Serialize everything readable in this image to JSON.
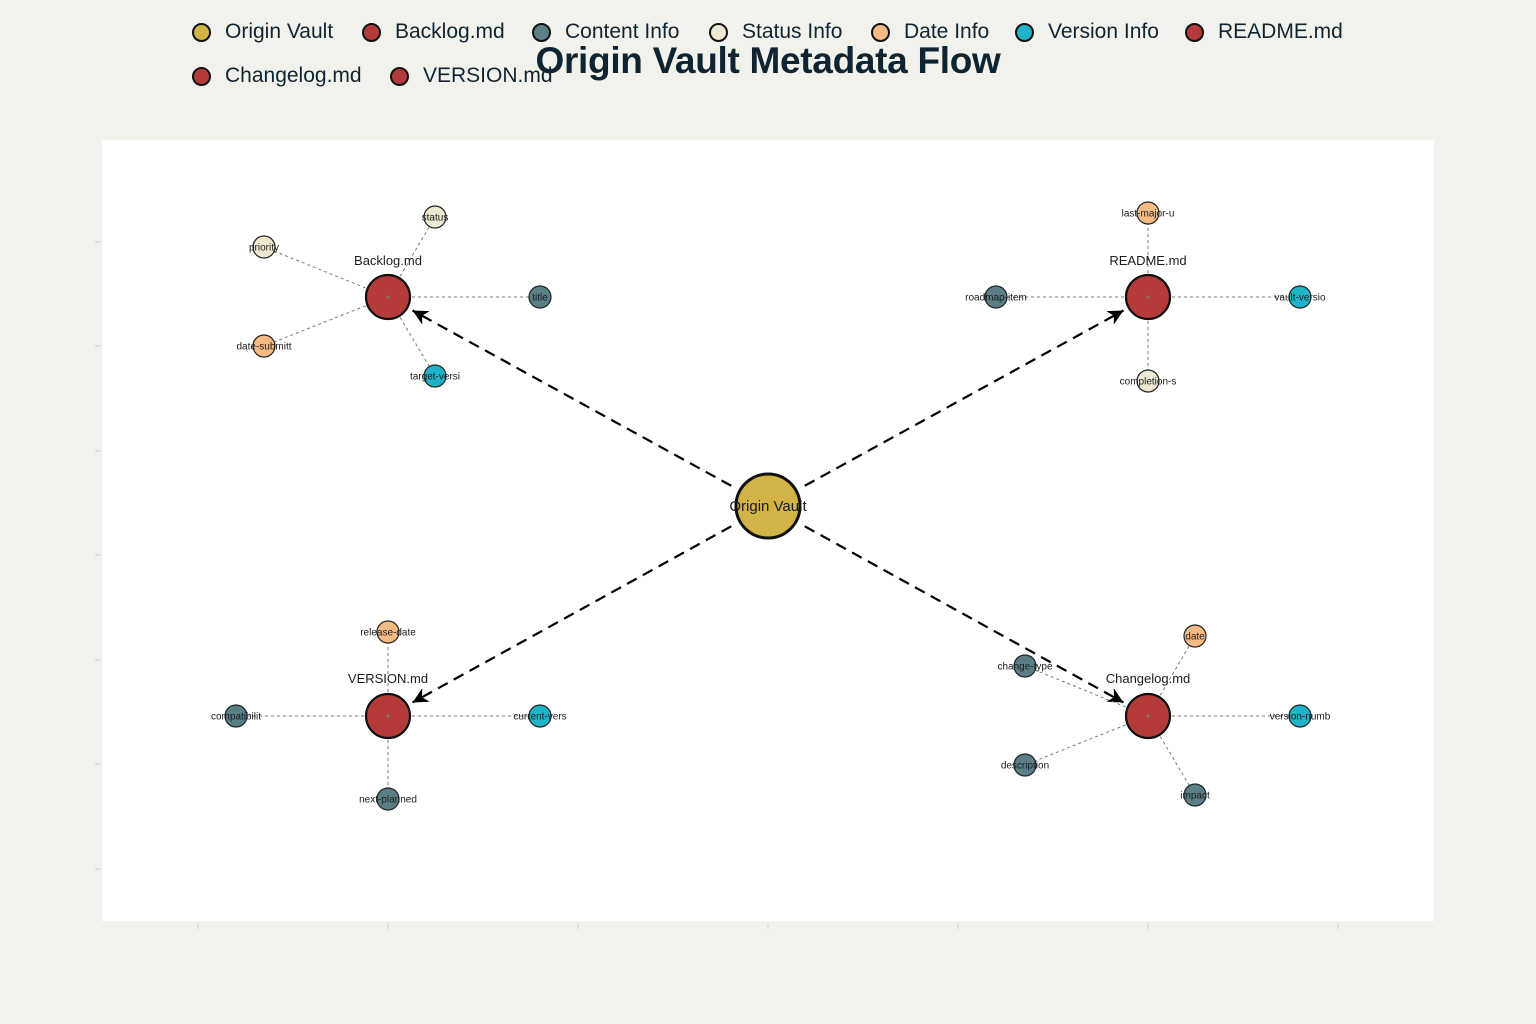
{
  "title": "Origin Vault Metadata Flow",
  "colors": {
    "origin": "#d1b445",
    "file": "#b53b3b",
    "content": "#5b7f87",
    "status": "#ece8d2",
    "date": "#f5bb84",
    "version": "#1fb3c9",
    "plot_bg": "#ffffff",
    "page_bg": "#f2f2ec"
  },
  "legend": [
    {
      "label": "Origin Vault",
      "color": "#d1b445"
    },
    {
      "label": "Backlog.md",
      "color": "#b53b3b"
    },
    {
      "label": "Content Info",
      "color": "#5b7f87"
    },
    {
      "label": "Status Info",
      "color": "#ece8d2"
    },
    {
      "label": "Date Info",
      "color": "#f5bb84"
    },
    {
      "label": "Version Info",
      "color": "#1fb3c9"
    },
    {
      "label": "README.md",
      "color": "#b53b3b"
    },
    {
      "label": "Changelog.md",
      "color": "#b53b3b"
    },
    {
      "label": "VERSION.md",
      "color": "#b53b3b"
    }
  ],
  "center": {
    "id": "origin",
    "label": "Origin Vault",
    "category": "origin"
  },
  "files": [
    {
      "id": "backlog",
      "label": "Backlog.md",
      "children": [
        {
          "label": "status",
          "category": "status"
        },
        {
          "label": "priority",
          "category": "status"
        },
        {
          "label": "title",
          "category": "content"
        },
        {
          "label": "date-submitt",
          "category": "date"
        },
        {
          "label": "target-versi",
          "category": "version"
        }
      ]
    },
    {
      "id": "readme",
      "label": "README.md",
      "children": [
        {
          "label": "last-major-u",
          "category": "date"
        },
        {
          "label": "roadmap-item",
          "category": "content"
        },
        {
          "label": "vault-versio",
          "category": "version"
        },
        {
          "label": "completion-s",
          "category": "status"
        }
      ]
    },
    {
      "id": "version",
      "label": "VERSION.md",
      "children": [
        {
          "label": "release-date",
          "category": "date"
        },
        {
          "label": "compatibilit",
          "category": "content"
        },
        {
          "label": "current-vers",
          "category": "version"
        },
        {
          "label": "next-planned",
          "category": "content"
        }
      ]
    },
    {
      "id": "changelog",
      "label": "Changelog.md",
      "children": [
        {
          "label": "date",
          "category": "date"
        },
        {
          "label": "change-type",
          "category": "content"
        },
        {
          "label": "version-numb",
          "category": "version"
        },
        {
          "label": "description",
          "category": "content"
        },
        {
          "label": "impact",
          "category": "content"
        }
      ]
    }
  ]
}
